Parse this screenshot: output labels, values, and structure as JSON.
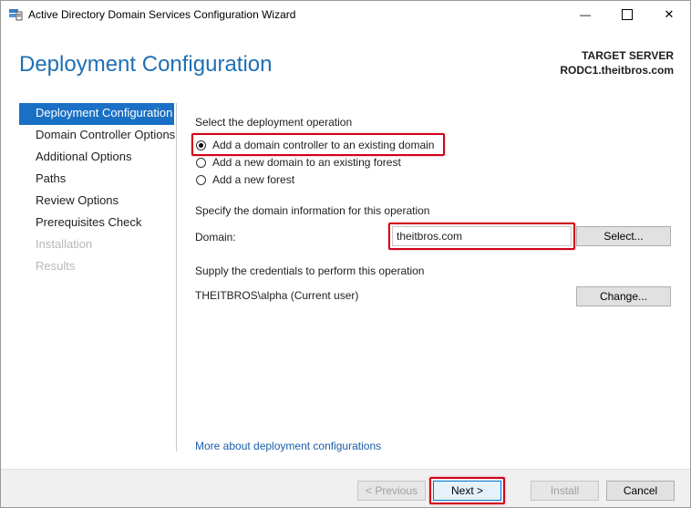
{
  "window": {
    "title": "Active Directory Domain Services Configuration Wizard",
    "minimize_glyph": "—",
    "maximize_glyph": "☐",
    "close_glyph": "✕"
  },
  "header": {
    "title": "Deployment Configuration",
    "target_label": "TARGET SERVER",
    "target_name": "RODC1.theitbros.com"
  },
  "sidebar": {
    "items": [
      {
        "label": "Deployment Configuration",
        "state": "active"
      },
      {
        "label": "Domain Controller Options",
        "state": "normal"
      },
      {
        "label": "Additional Options",
        "state": "normal"
      },
      {
        "label": "Paths",
        "state": "normal"
      },
      {
        "label": "Review Options",
        "state": "normal"
      },
      {
        "label": "Prerequisites Check",
        "state": "normal"
      },
      {
        "label": "Installation",
        "state": "disabled"
      },
      {
        "label": "Results",
        "state": "disabled"
      }
    ]
  },
  "main": {
    "operation_label": "Select the deployment operation",
    "options": [
      {
        "label": "Add a domain controller to an existing domain",
        "selected": true
      },
      {
        "label": "Add a new domain to an existing forest",
        "selected": false
      },
      {
        "label": "Add a new forest",
        "selected": false
      }
    ],
    "domain_info_label": "Specify the domain information for this operation",
    "domain_label": "Domain:",
    "domain_value": "theitbros.com",
    "select_button": "Select...",
    "credentials_label": "Supply the credentials to perform this operation",
    "credentials_value": "THEITBROS\\alpha (Current user)",
    "change_button": "Change...",
    "more_link": "More about deployment configurations"
  },
  "footer": {
    "previous": "< Previous",
    "next": "Next >",
    "install": "Install",
    "cancel": "Cancel"
  },
  "colors": {
    "accent": "#1a70c4",
    "heading": "#1f6fb4",
    "highlight": "#d0021b",
    "link": "#1a5ea8"
  }
}
